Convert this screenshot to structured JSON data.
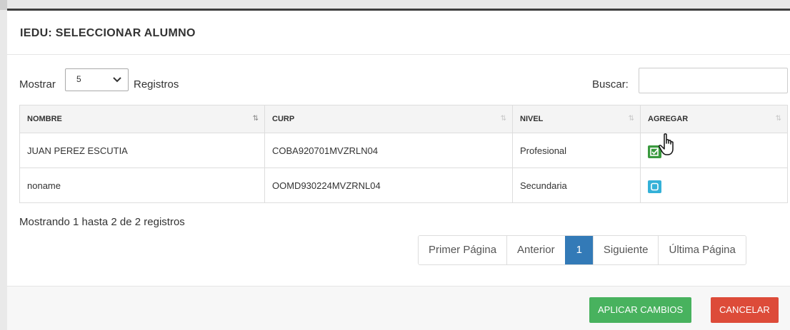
{
  "modal": {
    "title": "IEDU: SELECCIONAR ALUMNO"
  },
  "controls": {
    "show_label": "Mostrar",
    "page_size": "5",
    "records_label": "Registros",
    "search_label": "Buscar:",
    "search_value": ""
  },
  "table": {
    "columns": [
      "NOMBRE",
      "CURP",
      "NIVEL",
      "AGREGAR"
    ],
    "rows": [
      {
        "nombre": "JUAN PEREZ ESCUTIA",
        "curp": "COBA920701MVZRLN04",
        "nivel": "Profesional",
        "agregar": "checked"
      },
      {
        "nombre": "noname",
        "curp": "OOMD930224MVZRNL04",
        "nivel": "Secundaria",
        "agregar": "unchecked"
      }
    ]
  },
  "info": "Mostrando 1 hasta 2 de 2 registros",
  "pagination": {
    "first": "Primer Página",
    "prev": "Anterior",
    "current": "1",
    "next": "Siguiente",
    "last": "Última Página"
  },
  "footer": {
    "apply": "APLICAR CAMBIOS",
    "cancel": "CANCELAR"
  },
  "colors": {
    "primary": "#337ab7",
    "success": "#48b25e",
    "danger": "#dd4b39",
    "check_green": "#3a9a3e",
    "check_blue": "#34b1d8"
  }
}
